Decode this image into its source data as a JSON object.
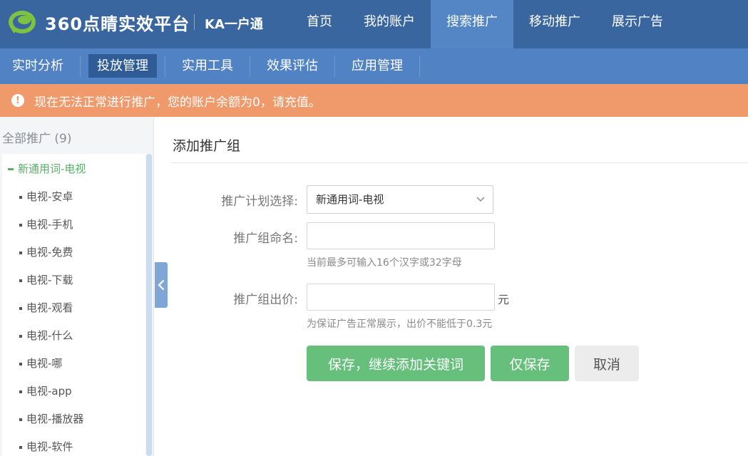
{
  "header": {
    "brand": "360点睛实效平台",
    "product": "KA一户通",
    "nav": [
      {
        "label": "首页",
        "active": false
      },
      {
        "label": "我的账户",
        "active": false
      },
      {
        "label": "搜索推广",
        "active": true
      },
      {
        "label": "移动推广",
        "active": false
      },
      {
        "label": "展示广告",
        "active": false
      }
    ]
  },
  "subnav": [
    {
      "label": "实时分析",
      "active": false
    },
    {
      "label": "投放管理",
      "active": true
    },
    {
      "label": "实用工具",
      "active": false
    },
    {
      "label": "效果评估",
      "active": false
    },
    {
      "label": "应用管理",
      "active": false
    }
  ],
  "alert": {
    "icon": "alert-circle-icon",
    "text": "现在无法正常进行推广，您的账户余额为0，请充值。"
  },
  "sidebar": {
    "all_label": "全部推广 (9)",
    "plan": "新通用词-电视",
    "groups": [
      "电视-安卓",
      "电视-手机",
      "电视-免费",
      "电视-下载",
      "电视-观看",
      "电视-什么",
      "电视-哪",
      "电视-app",
      "电视-播放器",
      "电视-软件"
    ]
  },
  "form": {
    "title": "添加推广组",
    "plan_label": "推广计划选择:",
    "plan_value": "新通用词-电视",
    "name_label": "推广组命名:",
    "name_value": "",
    "name_hint": "当前最多可输入16个汉字或32字母",
    "bid_label": "推广组出价:",
    "bid_value": "",
    "bid_unit": "元",
    "bid_hint": "为保证广告正常展示，出价不能低于0.3元",
    "btn_save_continue": "保存，继续添加关键词",
    "btn_save_only": "仅保存",
    "btn_cancel": "取消"
  },
  "colors": {
    "topbar": "#3a669f",
    "subnav": "#5082c4",
    "alert": "#f0996b",
    "accent_green": "#66c07c"
  }
}
